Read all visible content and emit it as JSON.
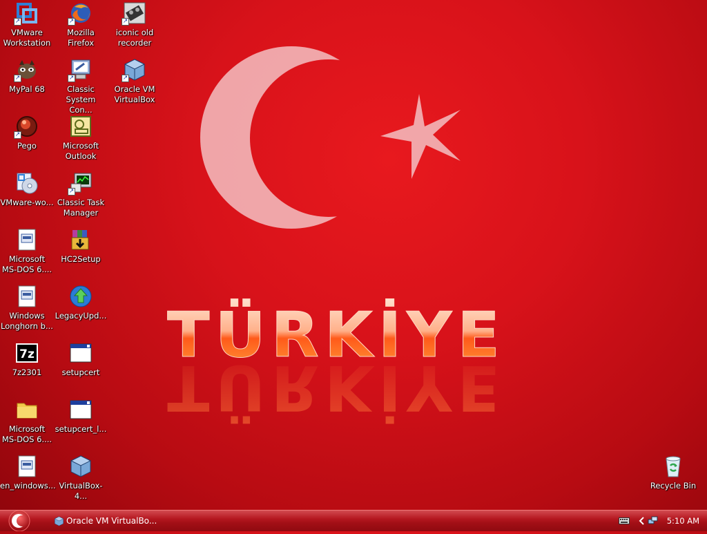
{
  "desktop": {
    "icons": [
      {
        "label": "VMware\nWorkstation",
        "shortcut": true,
        "icon": "vmware-icon"
      },
      {
        "label": "Mozilla\nFirefox",
        "shortcut": true,
        "icon": "firefox-icon"
      },
      {
        "label": "iconic old\nrecorder",
        "shortcut": true,
        "icon": "recorder-icon"
      },
      {
        "label": "MyPal 68",
        "shortcut": true,
        "icon": "mypal-icon"
      },
      {
        "label": "Classic\nSystem Con...",
        "shortcut": true,
        "icon": "system-config-icon"
      },
      {
        "label": "Oracle VM\nVirtualBox",
        "shortcut": true,
        "icon": "virtualbox-icon"
      },
      {
        "label": "Pego",
        "shortcut": true,
        "icon": "pego-icon"
      },
      {
        "label": "Microsoft\nOutlook",
        "shortcut": false,
        "icon": "outlook-icon"
      },
      {
        "label": "VMware-wo...",
        "shortcut": false,
        "icon": "installer-cd-icon"
      },
      {
        "label": "Classic Task\nManager",
        "shortcut": true,
        "icon": "task-manager-icon"
      },
      {
        "label": "Microsoft\nMS-DOS 6....",
        "shortcut": false,
        "icon": "disk-image-icon"
      },
      {
        "label": "HC2Setup",
        "shortcut": false,
        "icon": "winrar-sfx-icon"
      },
      {
        "label": "Windows\nLonghorn b...",
        "shortcut": false,
        "icon": "disk-image-icon"
      },
      {
        "label": "LegacyUpd...",
        "shortcut": false,
        "icon": "legacy-update-icon"
      },
      {
        "label": "7z2301",
        "shortcut": false,
        "icon": "7zip-icon"
      },
      {
        "label": "setupcert",
        "shortcut": false,
        "icon": "application-window-icon"
      },
      {
        "label": "Microsoft\nMS-DOS 6....",
        "shortcut": false,
        "icon": "folder-icon"
      },
      {
        "label": "setupcert_l...",
        "shortcut": false,
        "icon": "application-window-icon"
      },
      {
        "label": "en_windows...",
        "shortcut": false,
        "icon": "disk-image-icon"
      },
      {
        "label": "VirtualBox-4...",
        "shortcut": false,
        "icon": "virtualbox-installer-icon"
      },
      {
        "label": "Recycle Bin",
        "shortcut": false,
        "icon": "recycle-bin-icon"
      }
    ],
    "wallpaper": {
      "text": "TÜRKİYE",
      "colors": {
        "red": "#d8121a",
        "crescent": "#f3c4c6"
      }
    }
  },
  "taskbar": {
    "start_icon": "crescent-start-icon",
    "tasks": [
      {
        "label": "Oracle VM VirtualBo...",
        "icon": "virtualbox-icon"
      }
    ],
    "tray": {
      "icons": [
        "keyboard-icon",
        "chevron-left-icon",
        "network-icon"
      ],
      "clock": "5:10 AM"
    }
  }
}
